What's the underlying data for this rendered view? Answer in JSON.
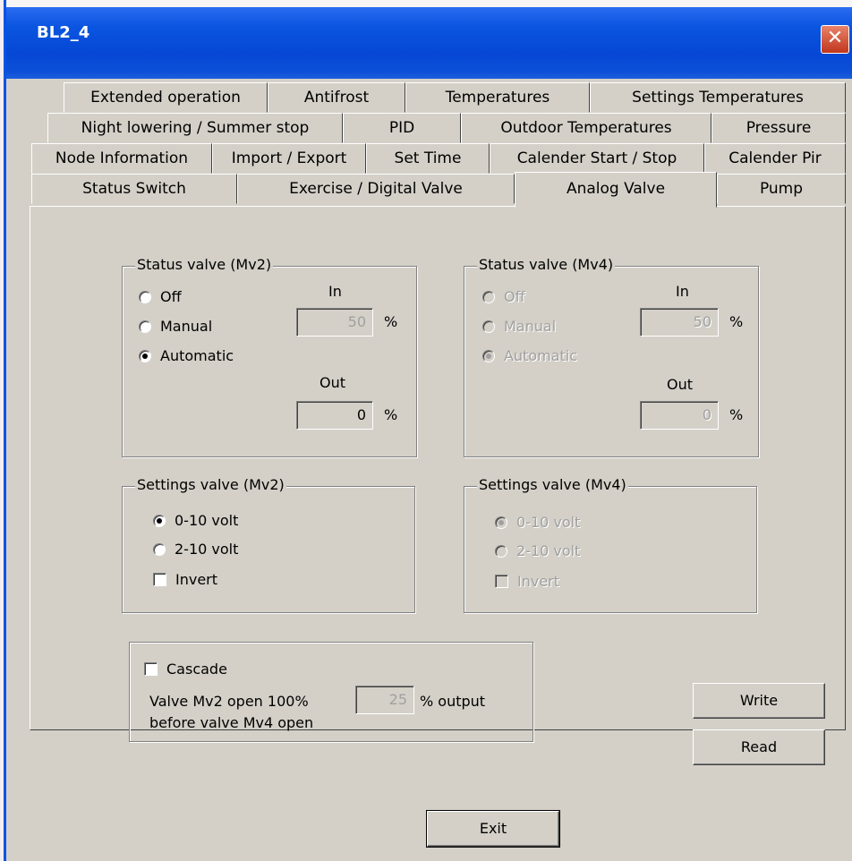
{
  "window": {
    "title": "BL2_4",
    "close_glyph": "✕"
  },
  "tabs": {
    "row1": [
      "Extended operation",
      "Antifrost",
      "Temperatures",
      "Settings Temperatures"
    ],
    "row2": [
      "Night lowering / Summer stop",
      "PID",
      "Outdoor Temperatures",
      "Pressure"
    ],
    "row3": [
      "Node Information",
      "Import / Export",
      "Set Time",
      "Calender Start / Stop",
      "Calender Pir"
    ],
    "row4": [
      "Status Switch",
      "Exercise / Digital Valve",
      "Analog Valve",
      "Pump"
    ],
    "active": "Analog Valve"
  },
  "status_mv2": {
    "legend": "Status valve (Mv2)",
    "off": "Off",
    "manual": "Manual",
    "automatic": "Automatic",
    "selected": "Automatic",
    "in_label": "In",
    "in_value": "50",
    "in_unit": "%",
    "out_label": "Out",
    "out_value": "0",
    "out_unit": "%"
  },
  "status_mv4": {
    "legend": "Status valve (Mv4)",
    "off": "Off",
    "manual": "Manual",
    "automatic": "Automatic",
    "selected": "Automatic",
    "in_label": "In",
    "in_value": "50",
    "in_unit": "%",
    "out_label": "Out",
    "out_value": "0",
    "out_unit": "%"
  },
  "settings_mv2": {
    "legend": "Settings valve (Mv2)",
    "opt1": "0-10 volt",
    "opt2": "2-10 volt",
    "selected": "0-10 volt",
    "invert": "Invert",
    "invert_checked": false
  },
  "settings_mv4": {
    "legend": "Settings valve (Mv4)",
    "opt1": "0-10 volt",
    "opt2": "2-10 volt",
    "selected": "0-10 volt",
    "invert": "Invert",
    "invert_checked": false
  },
  "cascade": {
    "label": "Cascade",
    "checked": false,
    "line1": "Valve Mv2 open 100%",
    "line2": "before valve Mv4 open",
    "value": "25",
    "unit": "% output"
  },
  "buttons": {
    "write": "Write",
    "read": "Read",
    "exit": "Exit"
  }
}
